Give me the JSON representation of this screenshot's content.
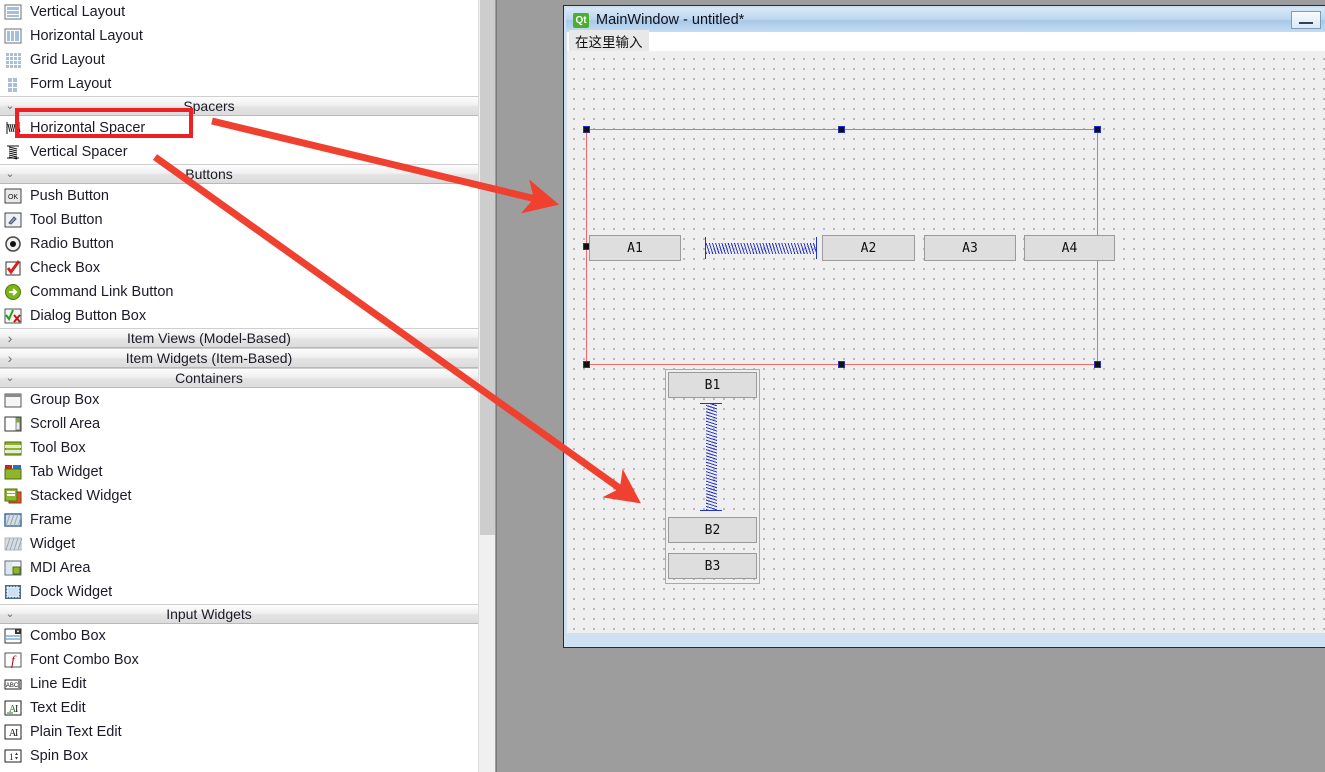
{
  "widget_box": {
    "groups": [
      {
        "header": null,
        "items": [
          {
            "label": "Vertical Layout",
            "icon": "vertical-layout-icon"
          },
          {
            "label": "Horizontal Layout",
            "icon": "horizontal-layout-icon"
          },
          {
            "label": "Grid Layout",
            "icon": "grid-layout-icon"
          },
          {
            "label": "Form Layout",
            "icon": "form-layout-icon"
          }
        ]
      },
      {
        "header": {
          "title": "Spacers",
          "chevron": "expanded"
        },
        "items": [
          {
            "label": "Horizontal Spacer",
            "icon": "horizontal-spacer-icon",
            "highlighted": true
          },
          {
            "label": "Vertical Spacer",
            "icon": "vertical-spacer-icon"
          }
        ]
      },
      {
        "header": {
          "title": "Buttons",
          "chevron": "expanded"
        },
        "items": [
          {
            "label": "Push Button",
            "icon": "push-button-icon"
          },
          {
            "label": "Tool Button",
            "icon": "tool-button-icon"
          },
          {
            "label": "Radio Button",
            "icon": "radio-button-icon"
          },
          {
            "label": "Check Box",
            "icon": "check-box-icon"
          },
          {
            "label": "Command Link Button",
            "icon": "command-link-button-icon"
          },
          {
            "label": "Dialog Button Box",
            "icon": "dialog-button-box-icon"
          }
        ]
      },
      {
        "header": {
          "title": "Item Views (Model-Based)",
          "chevron": "collapsed"
        },
        "items": []
      },
      {
        "header": {
          "title": "Item Widgets (Item-Based)",
          "chevron": "collapsed"
        },
        "items": []
      },
      {
        "header": {
          "title": "Containers",
          "chevron": "expanded"
        },
        "items": [
          {
            "label": "Group Box",
            "icon": "group-box-icon"
          },
          {
            "label": "Scroll Area",
            "icon": "scroll-area-icon"
          },
          {
            "label": "Tool Box",
            "icon": "tool-box-icon"
          },
          {
            "label": "Tab Widget",
            "icon": "tab-widget-icon"
          },
          {
            "label": "Stacked Widget",
            "icon": "stacked-widget-icon"
          },
          {
            "label": "Frame",
            "icon": "frame-icon"
          },
          {
            "label": "Widget",
            "icon": "widget-icon"
          },
          {
            "label": "MDI Area",
            "icon": "mdi-area-icon"
          },
          {
            "label": "Dock Widget",
            "icon": "dock-widget-icon"
          }
        ]
      },
      {
        "header": {
          "title": "Input Widgets",
          "chevron": "expanded"
        },
        "items": [
          {
            "label": "Combo Box",
            "icon": "combo-box-icon"
          },
          {
            "label": "Font Combo Box",
            "icon": "font-combo-box-icon"
          },
          {
            "label": "Line Edit",
            "icon": "line-edit-icon"
          },
          {
            "label": "Text Edit",
            "icon": "text-edit-icon"
          },
          {
            "label": "Plain Text Edit",
            "icon": "plain-text-edit-icon"
          },
          {
            "label": "Spin Box",
            "icon": "spin-box-icon"
          }
        ]
      }
    ]
  },
  "main_window": {
    "title": "MainWindow - untitled*",
    "logo_text": "Qt",
    "minimize_label": "",
    "menubar": {
      "type_here": "在这里输入"
    },
    "horizontal_layout": {
      "selected": true,
      "children": [
        {
          "type": "button",
          "label": "A1"
        },
        {
          "type": "horizontal-spacer",
          "label": ""
        },
        {
          "type": "button",
          "label": "A2"
        },
        {
          "type": "button",
          "label": "A3"
        },
        {
          "type": "button",
          "label": "A4"
        }
      ]
    },
    "vertical_layout": {
      "selected": false,
      "children": [
        {
          "type": "button",
          "label": "B1"
        },
        {
          "type": "vertical-spacer",
          "label": ""
        },
        {
          "type": "button",
          "label": "B2"
        },
        {
          "type": "button",
          "label": "B3"
        }
      ]
    }
  },
  "annotations": {
    "highlight_color": "#ed2024",
    "arrow_color": "#f0402f",
    "highlight_box_target": "Horizontal Spacer",
    "arrows": [
      {
        "from_label": "Horizontal Spacer",
        "to_label": "horizontal spacer in A row"
      },
      {
        "from_label": "Vertical Spacer",
        "to_label": "vertical spacer in B column"
      }
    ]
  }
}
